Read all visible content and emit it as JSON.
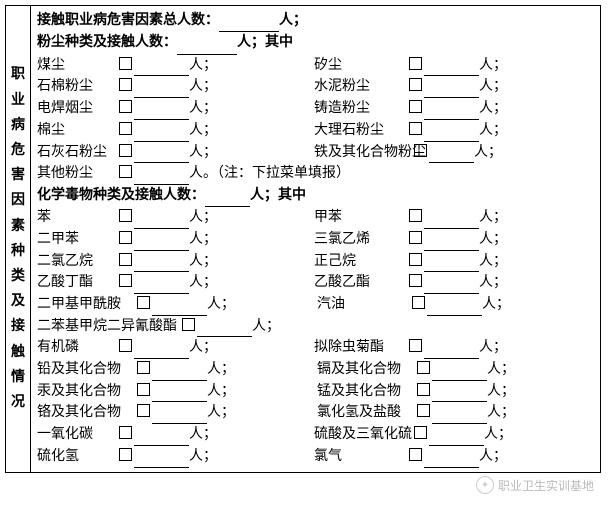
{
  "side_label": "职业病危害因素种类及接触情况",
  "headers": {
    "total": {
      "label": "接触职业病危害因素总人数：",
      "unit": "人；"
    },
    "dust": {
      "label": "粉尘种类及接触人数：",
      "unit": "人；其中"
    },
    "chem": {
      "label": "化学毒物种类及接触人数：",
      "unit": "人；其中"
    }
  },
  "dust_rows": [
    {
      "l": "煤尘",
      "r": "矽尘"
    },
    {
      "l": "石棉粉尘",
      "r": "水泥粉尘"
    },
    {
      "l": "电焊烟尘",
      "r": "铸造粉尘"
    },
    {
      "l": "棉尘",
      "r": "大理石粉尘"
    },
    {
      "l": "石灰石粉尘",
      "r": "铁及其化合物粉尘",
      "tight": true
    }
  ],
  "dust_other": {
    "l": "其他粉尘",
    "note": "（注：下拉菜单填报）",
    "unit": "人。"
  },
  "chem_rows_a": [
    {
      "l": "苯",
      "r": "甲苯"
    },
    {
      "l": "二甲苯",
      "r": "三氯乙烯"
    },
    {
      "l": "二氯乙烷",
      "r": "正己烷"
    },
    {
      "l": "乙酸丁酯",
      "r": "乙酸乙酯"
    },
    {
      "l": "二甲基甲酰胺",
      "r": "汽油",
      "lw": true
    }
  ],
  "chem_single": {
    "l": "二苯基甲烷二异氰酸酯"
  },
  "chem_rows_b": [
    {
      "l": "有机磷",
      "r": "拟除虫菊酯"
    },
    {
      "l": "铅及其化合物",
      "r": "镉及其化合物",
      "lw": true
    },
    {
      "l": "汞及其化合物",
      "r": "锰及其化合物",
      "lw": true
    },
    {
      "l": "铬及其化合物",
      "r": "氯化氢及盐酸",
      "lw": true
    },
    {
      "l": "一氧化碳",
      "r": "硫酸及三氧化硫"
    },
    {
      "l": "硫化氢",
      "r": "氯气"
    }
  ],
  "unit_person": "人；",
  "watermark": "职业卫生实训基地"
}
